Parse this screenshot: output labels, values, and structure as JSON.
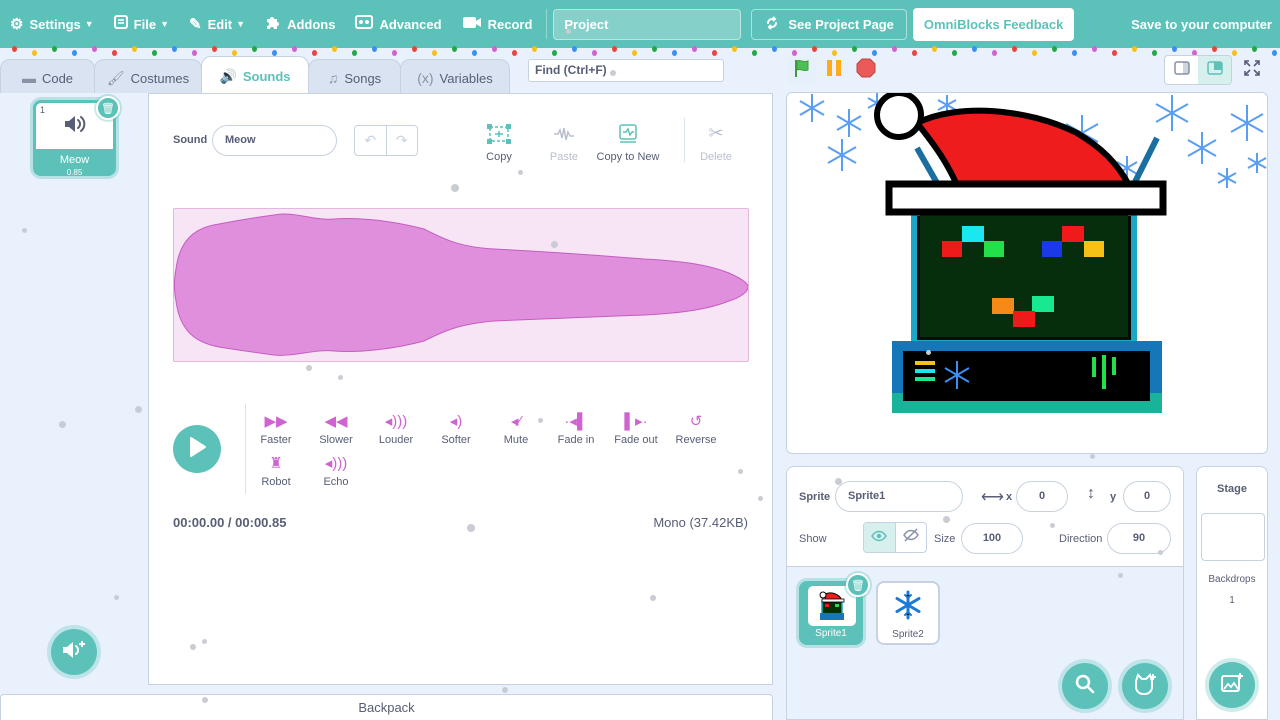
{
  "menu": {
    "settings": "Settings",
    "file": "File",
    "edit": "Edit",
    "addons": "Addons",
    "advanced": "Advanced",
    "record": "Record",
    "project_title": "Project",
    "see_project_page": "See Project Page",
    "feedback": "OmniBlocks Feedback",
    "save": "Save to your computer"
  },
  "tabs": [
    {
      "label": "Code",
      "icon": "code-icon"
    },
    {
      "label": "Costumes",
      "icon": "brush-icon"
    },
    {
      "label": "Sounds",
      "icon": "speaker-icon",
      "active": true
    },
    {
      "label": "Songs",
      "icon": "music-note-icon"
    },
    {
      "label": "Variables",
      "icon": "variable-icon"
    }
  ],
  "find": {
    "placeholder": "Find (Ctrl+F)"
  },
  "sound_list": {
    "items": [
      {
        "number": "1",
        "name": "Meow",
        "duration": "0.85"
      }
    ]
  },
  "editor": {
    "sound_label": "Sound",
    "sound_name": "Meow",
    "tools": {
      "copy": "Copy",
      "paste": "Paste",
      "copy_to_new": "Copy to New",
      "delete": "Delete"
    },
    "effects": [
      {
        "label": "Faster",
        "icon": "faster-icon"
      },
      {
        "label": "Slower",
        "icon": "slower-icon"
      },
      {
        "label": "Louder",
        "icon": "louder-icon"
      },
      {
        "label": "Softer",
        "icon": "softer-icon"
      },
      {
        "label": "Mute",
        "icon": "mute-icon"
      },
      {
        "label": "Fade in",
        "icon": "fade-in-icon"
      },
      {
        "label": "Fade out",
        "icon": "fade-out-icon"
      },
      {
        "label": "Reverse",
        "icon": "reverse-icon"
      },
      {
        "label": "Robot",
        "icon": "robot-icon"
      },
      {
        "label": "Echo",
        "icon": "echo-icon"
      }
    ],
    "time": "00:00.00 / 00:00.85",
    "format": "Mono (37.42KB)"
  },
  "backpack": "Backpack",
  "sprite_info": {
    "sprite_label": "Sprite",
    "sprite_name": "Sprite1",
    "x_label": "x",
    "x": "0",
    "y_label": "y",
    "y": "0",
    "show_label": "Show",
    "size_label": "Size",
    "size": "100",
    "direction_label": "Direction",
    "direction": "90"
  },
  "sprites": [
    {
      "name": "Sprite1",
      "selected": true
    },
    {
      "name": "Sprite2",
      "selected": false
    }
  ],
  "stage_pane": {
    "title": "Stage",
    "backdrops_label": "Backdrops",
    "backdrops_count": "1"
  },
  "colors": {
    "accent": "#5cc2b9",
    "sound": "#cf63cf",
    "waveform_fill": "#e08fdd",
    "stop": "#ec5959",
    "flag": "#4cbf56"
  }
}
